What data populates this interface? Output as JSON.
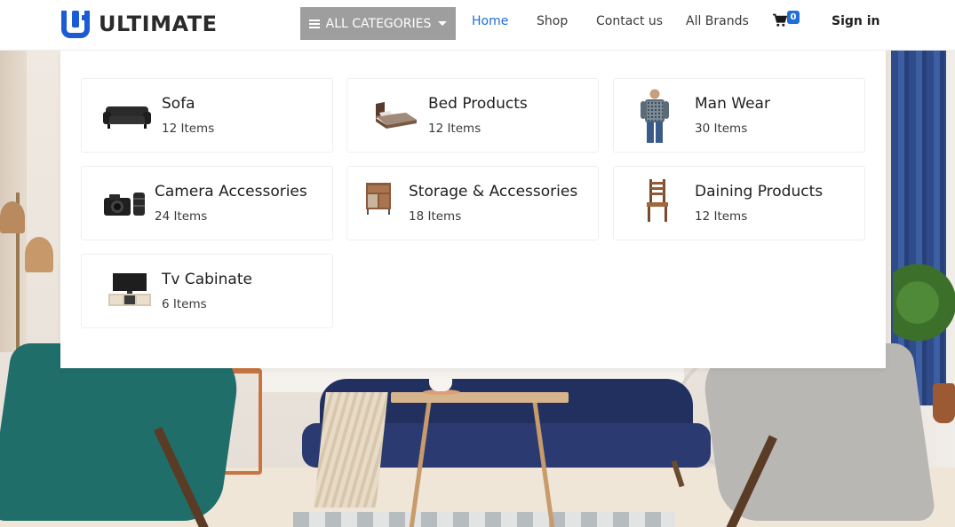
{
  "brand": {
    "name": "ULTIMATE",
    "accent_color": "#1c5bd6"
  },
  "nav": {
    "categories_button": "ALL CATEGORIES",
    "links": [
      {
        "label": "Home",
        "active": true
      },
      {
        "label": "Shop",
        "active": false
      },
      {
        "label": "Contact us",
        "active": false
      },
      {
        "label": "All Brands",
        "active": false
      }
    ],
    "cart_count": "0",
    "sign_in": "Sign in"
  },
  "categories": [
    {
      "name": "Sofa",
      "count": "12 Items",
      "icon": "sofa-icon"
    },
    {
      "name": "Bed Products",
      "count": "12 Items",
      "icon": "bed-icon"
    },
    {
      "name": "Man Wear",
      "count": "30 Items",
      "icon": "man-wear-icon"
    },
    {
      "name": "Camera Accessories",
      "count": "24 Items",
      "icon": "camera-icon"
    },
    {
      "name": "Storage & Accessories",
      "count": "18 Items",
      "icon": "storage-icon"
    },
    {
      "name": "Daining Products",
      "count": "12 Items",
      "icon": "chair-icon"
    },
    {
      "name": "Tv Cabinate",
      "count": "6 Items",
      "icon": "tv-cabinet-icon"
    }
  ]
}
